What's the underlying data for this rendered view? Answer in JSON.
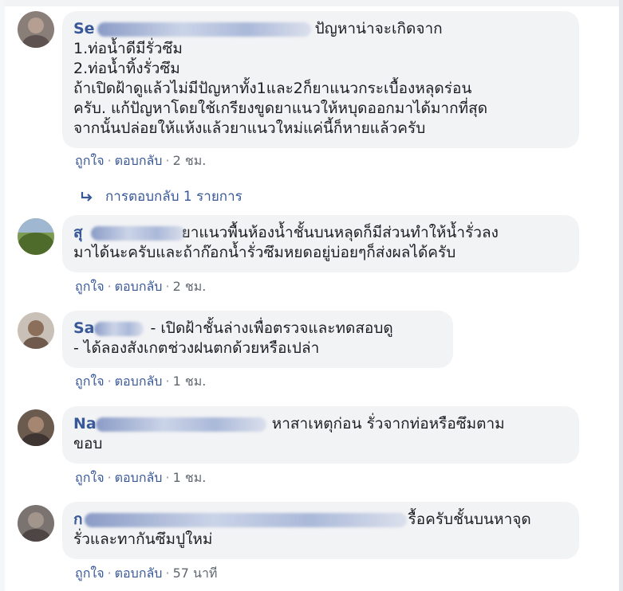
{
  "comments": [
    {
      "author": "Se",
      "text_lines": [
        "ปัญหาน่าจะเกิดจาก",
        "1.ท่อน้ำดีมีรั่วซึม",
        "2.ท่อน้ำทิ้งรั่วซึม",
        "ถ้าเปิดฝ้าดูแล้วไม่มีปัญหาทั้ง1และ2ก็ยาแนวกระเบื้องหลุดร่อน",
        "ครับ. แก้ปัญหาโดยใช้เกรียงขูดยาแนวให้หบุดออกมาได้มากที่สุด",
        "จากนั้นปล่อยให้แห้งแล้วยาแนวใหม่แค่นี้ก็หายแล้วครับ"
      ],
      "like": "ถูกใจ",
      "reply": "ตอบกลับ",
      "time": "2 ชม.",
      "replies_link": "การตอบกลับ 1 รายการ"
    },
    {
      "author": "สุ",
      "text_lines": [
        "ยาแนวพื้นห้องน้ำชั้นบนหลุดก็มีส่วนทำให้น้ำรั่วลง",
        "มาได้นะครับและถ้าก๊อกน้ำรั่วซึมหยดอยู่บ่อยๆก็ส่งผลได้ครับ"
      ],
      "like": "ถูกใจ",
      "reply": "ตอบกลับ",
      "time": "2 ชม."
    },
    {
      "author": "Sa",
      "text_lines": [
        "- เปิดฝ้าชั้นล่างเพื่อตรวจและทดสอบดู",
        "- ได้ลองสังเกตช่วงฝนตกด้วยหรือเปล่า"
      ],
      "like": "ถูกใจ",
      "reply": "ตอบกลับ",
      "time": "1 ชม."
    },
    {
      "author": "Na",
      "text_lines": [
        "หาสาเหตุก่อน รั่วจากท่อหรือซึมตาม",
        "ขอบ"
      ],
      "like": "ถูกใจ",
      "reply": "ตอบกลับ",
      "time": "1 ชม."
    },
    {
      "author": "ก",
      "text_lines": [
        "รื้อครับชั้นบนหาจุด",
        "รั่วและทากันซึมปูใหม่"
      ],
      "like": "ถูกใจ",
      "reply": "ตอบกลับ",
      "time": "57 นาที"
    }
  ],
  "colors": {
    "author": "#385898",
    "bubble": "#f2f3f5",
    "meta": "#616770"
  },
  "icons": {
    "reply_arrow": "reply-arrow-icon"
  }
}
